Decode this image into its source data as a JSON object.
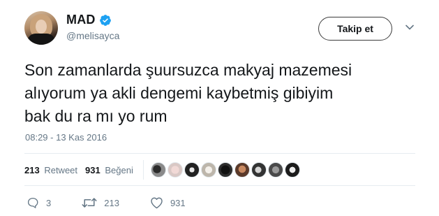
{
  "user": {
    "display_name": "MAD",
    "handle": "@melisayca",
    "verified": true
  },
  "header": {
    "follow_label": "Takip et",
    "menu_icon": "chevron-down-icon"
  },
  "tweet": {
    "lines": [
      "Son zamanlarda şuursuzca makyaj mazemesi",
      "alıyorum ya akli dengemi kaybetmiş gibiyim",
      "bak du ra mı yo rum"
    ],
    "timestamp": "08:29 - 13 Kas 2016"
  },
  "stats": {
    "retweet_count": "213",
    "retweet_label": "Retweet",
    "like_count": "931",
    "like_label": "Beğeni",
    "liker_avatar_count": 9
  },
  "actions": {
    "reply_count": "3",
    "retweet_count": "213",
    "like_count": "931"
  },
  "colors": {
    "text": "#14171a",
    "secondary": "#657786",
    "divider": "#e6ecf0",
    "verified": "#1da1f2"
  }
}
